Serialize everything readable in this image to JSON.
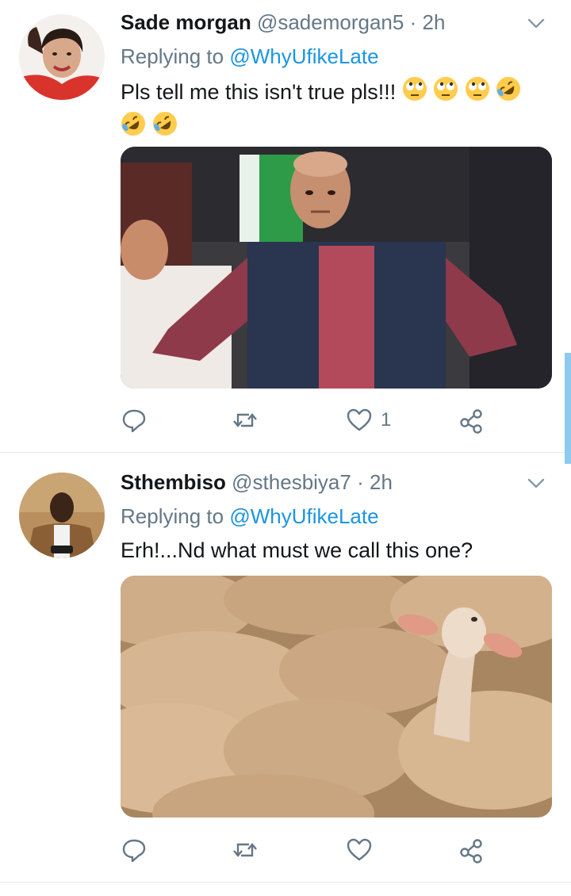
{
  "tweets": [
    {
      "name": "Sade morgan",
      "handle": "@sademorgan5",
      "separator": "·",
      "time": "2h",
      "replying_prefix": "Replying to",
      "replying_to": "@WhyUfikeLate",
      "text": "Pls tell me this isn't true pls!!!",
      "emojis": [
        "face-with-rolling-eyes",
        "face-with-rolling-eyes",
        "face-with-rolling-eyes",
        "rolling-on-floor-laughing",
        "rolling-on-floor-laughing",
        "rolling-on-floor-laughing"
      ],
      "like_count": "1",
      "colors": {
        "avatar_bg": "#d9342c",
        "media_bg": "#3b3a3f"
      }
    },
    {
      "name": "Sthembiso",
      "handle": "@sthesbiya7",
      "separator": "·",
      "time": "2h",
      "replying_prefix": "Replying to",
      "replying_to": "@WhyUfikeLate",
      "text": "Erh!...Nd what must we call this one?",
      "like_count": "",
      "colors": {
        "avatar_bg": "#b98f5e",
        "media_bg": "#c9a582"
      }
    }
  ],
  "colors": {
    "accent": "#1b95e0",
    "secondary": "#657786",
    "divider": "#e1e8ed",
    "scrollbar": "#8ec9ee"
  }
}
